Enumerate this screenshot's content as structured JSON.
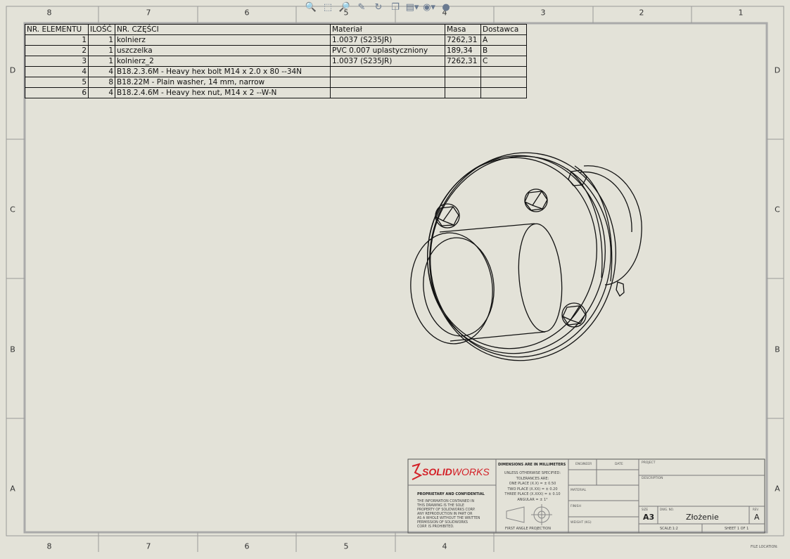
{
  "zones": {
    "top": [
      "8",
      "7",
      "6",
      "5",
      "4",
      "3",
      "2",
      "1"
    ],
    "bottom": [
      "8",
      "7",
      "6",
      "5",
      "4"
    ],
    "rows": [
      "D",
      "C",
      "B",
      "A"
    ]
  },
  "toolbar": {
    "icons": [
      "zoom-to-fit-icon",
      "zoom-to-area-icon",
      "zoom-in-out-icon",
      "select-icon",
      "rotate-icon",
      "view-orientation-icon",
      "display-style-icon",
      "hide-show-icon",
      "appearance-icon"
    ]
  },
  "bom": {
    "headers": [
      "NR. ELEMENTU",
      "ILOŚĆ",
      "NR. CZĘŚCI",
      "Materiał",
      "Masa",
      "Dostawca"
    ],
    "rows": [
      [
        "1",
        "1",
        "kolnierz",
        "1.0037 (S235JR)",
        "7262,31",
        "A"
      ],
      [
        "2",
        "1",
        "uszczelka",
        "PVC 0.007 uplastyczniony",
        "189,34",
        "B"
      ],
      [
        "3",
        "1",
        "kolnierz_2",
        "1.0037 (S235JR)",
        "7262,31",
        "C"
      ],
      [
        "4",
        "4",
        "B18.2.3.6M - Heavy hex bolt M14 x 2.0 x 80 --34N",
        "",
        "",
        ""
      ],
      [
        "5",
        "8",
        "B18.22M - Plain washer, 14 mm, narrow",
        "",
        "",
        ""
      ],
      [
        "6",
        "4",
        "B18.2.4.6M - Heavy hex nut,  M14 x 2 --W-N",
        "",
        "",
        ""
      ]
    ]
  },
  "title_block": {
    "logo_ds": "DS",
    "logo_solid": "SOLID",
    "logo_works": "WORKS",
    "dims_title": "DIMENSIONS ARE IN  MILLIMETERS",
    "tol_1": "UNLESS OTHERWISE SPECIFIED:",
    "tol_2": "TOLERANCES ARE:",
    "tol_3": "ONE PLACE (X.X) = ± 0.50",
    "tol_4": "TWO PLACE (X.XX) = ± 0.20",
    "tol_5": "THREE PLACE (X.XXX) = ± 0.10",
    "tol_6": "ANGULAR = ± 1°",
    "engineer": "ENGINEER",
    "date": "DATE",
    "project": "PROJECT",
    "description": "DESCRIPTION",
    "material": "MATERIAL",
    "finish": "FINISH",
    "weight": "WEIGHT (KG)",
    "proprietary": "PROPRIETARY AND CONFIDENTIAL",
    "prop_1": "THE INFORMATION CONTAINED IN",
    "prop_2": "THIS DRAWING IS THE SOLE",
    "prop_3": "PROPERTY OF SOLIDWORKS CORP.",
    "prop_4": "ANY REPRODUCTION IN PART OR",
    "prop_5": "AS A WHOLE WITHOUT THE WRITTEN",
    "prop_6": "PERMISSION OF SOLIDWORKS",
    "prop_7": "CORP. IS PROHIBITED.",
    "projection": "FIRST ANGLE PROJECTION",
    "size_label": "SIZE",
    "size_value": "A3",
    "dwg_label": "DWG. NO.",
    "dwg_value": "Złożenie",
    "rev_label": "REV.",
    "rev_value": "A",
    "scale": "SCALE:1:2",
    "sheet": "SHEET 1 OF 1",
    "file_location": "FILE LOCATION:"
  },
  "colors": {
    "background": "#e3e2d8",
    "border": "#999999",
    "ink": "#111111",
    "logo_red": "#d32027"
  }
}
